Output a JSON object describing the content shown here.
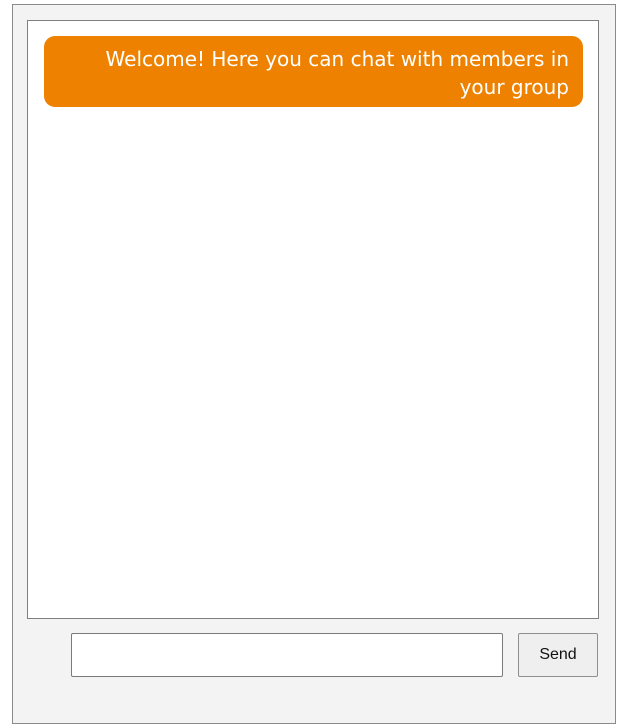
{
  "chat": {
    "messages": [
      {
        "text": "Welcome! Here you can chat with members in your group",
        "color": "#ee8200"
      }
    ]
  },
  "compose": {
    "input_value": "",
    "input_placeholder": "",
    "send_label": "Send"
  }
}
